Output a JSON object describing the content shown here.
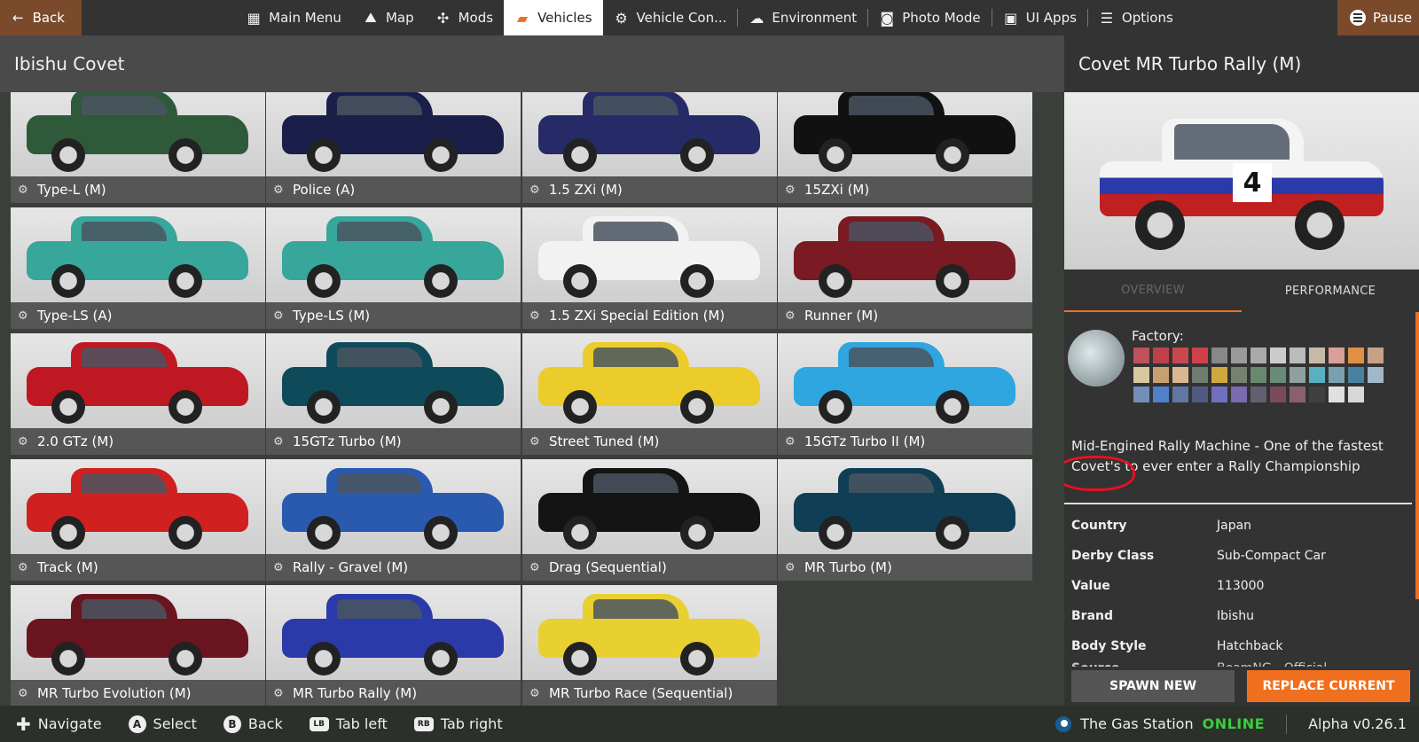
{
  "topbar": {
    "back_label": "Back",
    "pause_label": "Pause",
    "menu": [
      {
        "label": "Main Menu",
        "icon": "grid-icon"
      },
      {
        "label": "Map",
        "icon": "map-icon"
      },
      {
        "label": "Mods",
        "icon": "puzzle-icon"
      },
      {
        "label": "Vehicles",
        "icon": "car-icon",
        "active": true
      },
      {
        "label": "Vehicle Con...",
        "icon": "engine-icon"
      },
      {
        "label": "Environment",
        "icon": "weather-icon"
      },
      {
        "label": "Photo Mode",
        "icon": "camera-icon"
      },
      {
        "label": "UI Apps",
        "icon": "apps-icon"
      },
      {
        "label": "Options",
        "icon": "sliders-icon"
      }
    ]
  },
  "left": {
    "title": "Ibishu Covet"
  },
  "configs": [
    {
      "label": "Type-L (M)",
      "color": "#2e5a3a"
    },
    {
      "label": "Police (A)",
      "color": "#1a1f4a"
    },
    {
      "label": "1.5 ZXi (M)",
      "color": "#262a66"
    },
    {
      "label": "15ZXi (M)",
      "color": "#111111"
    },
    {
      "label": "Type-LS (A)",
      "color": "#37a69b"
    },
    {
      "label": "Type-LS (M)",
      "color": "#37a69b"
    },
    {
      "label": "1.5 ZXi Special Edition (M)",
      "color": "#f2f2f2"
    },
    {
      "label": "Runner (M)",
      "color": "#7a1a22"
    },
    {
      "label": "2.0 GTz (M)",
      "color": "#c01822"
    },
    {
      "label": "15GTz Turbo (M)",
      "color": "#0f4a5a"
    },
    {
      "label": "Street Tuned (M)",
      "color": "#eccc2a"
    },
    {
      "label": "15GTz Turbo II (M)",
      "color": "#2fa6e0"
    },
    {
      "label": "Track (M)",
      "color": "#d02020"
    },
    {
      "label": "Rally - Gravel (M)",
      "color": "#2a5ab0"
    },
    {
      "label": "Drag (Sequential)",
      "color": "#141414"
    },
    {
      "label": "MR Turbo (M)",
      "color": "#0f3e55"
    },
    {
      "label": "MR Turbo Evolution (M)",
      "color": "#6a1420"
    },
    {
      "label": "MR Turbo Rally (M)",
      "color": "#2a3aa8"
    },
    {
      "label": "MR Turbo Race (Sequential)",
      "color": "#e8d030"
    }
  ],
  "detail": {
    "title": "Covet MR Turbo Rally (M)",
    "tab_overview": "OVERVIEW",
    "tab_performance": "PERFORMANCE",
    "factory_label": "Factory:",
    "description": "Mid-Engined Rally Machine - One of the fastest Covet's to ever enter a Rally Championship",
    "swatches": [
      "#c0505a",
      "#c0404a",
      "#c84850",
      "#d04048",
      "#888888",
      "#9a9a9a",
      "#aaaaaa",
      "#cccccc",
      "#bcbcbc",
      "#c8b8a8",
      "#d8a098",
      "#e09040",
      "#c8a088",
      "#d8c8a0",
      "#c8a070",
      "#d8b890",
      "#707c70",
      "#d0a840",
      "#788070",
      "#6a8870",
      "#6a8a7a",
      "#90a0a0",
      "#5ab0c0",
      "#7aa0b0",
      "#4a80a0",
      "#a0b8c8",
      "#7090b8",
      "#5080c8",
      "#6078a0",
      "#505a80",
      "#7070c0",
      "#7a6ab0",
      "#606070",
      "#7a4a5a",
      "#8a6070",
      "#404040",
      "#e0e0e0",
      "#d8d8d8"
    ],
    "props": [
      {
        "key": "Country",
        "val": "Japan"
      },
      {
        "key": "Derby Class",
        "val": "Sub-Compact Car"
      },
      {
        "key": "Value",
        "val": "113000"
      },
      {
        "key": "Brand",
        "val": "Ibishu"
      },
      {
        "key": "Body Style",
        "val": "Hatchback"
      },
      {
        "key": "Source",
        "val": "BeamNG - Official"
      }
    ],
    "spawn_label": "SPAWN NEW",
    "replace_label": "REPLACE CURRENT"
  },
  "bottombar": {
    "hints": [
      {
        "glyph": "✚",
        "label": "Navigate",
        "kind": "dpad"
      },
      {
        "glyph": "A",
        "label": "Select",
        "kind": "round"
      },
      {
        "glyph": "B",
        "label": "Back",
        "kind": "round"
      },
      {
        "glyph": "LB",
        "label": "Tab left",
        "kind": "rect"
      },
      {
        "glyph": "RB",
        "label": "Tab right",
        "kind": "rect"
      }
    ],
    "server": "The Gas Station",
    "server_status": "ONLINE",
    "version": "Alpha v0.26.1"
  },
  "colors": {
    "accent": "#f07020",
    "online": "#3dcc3d",
    "annotation": "#e81020"
  }
}
